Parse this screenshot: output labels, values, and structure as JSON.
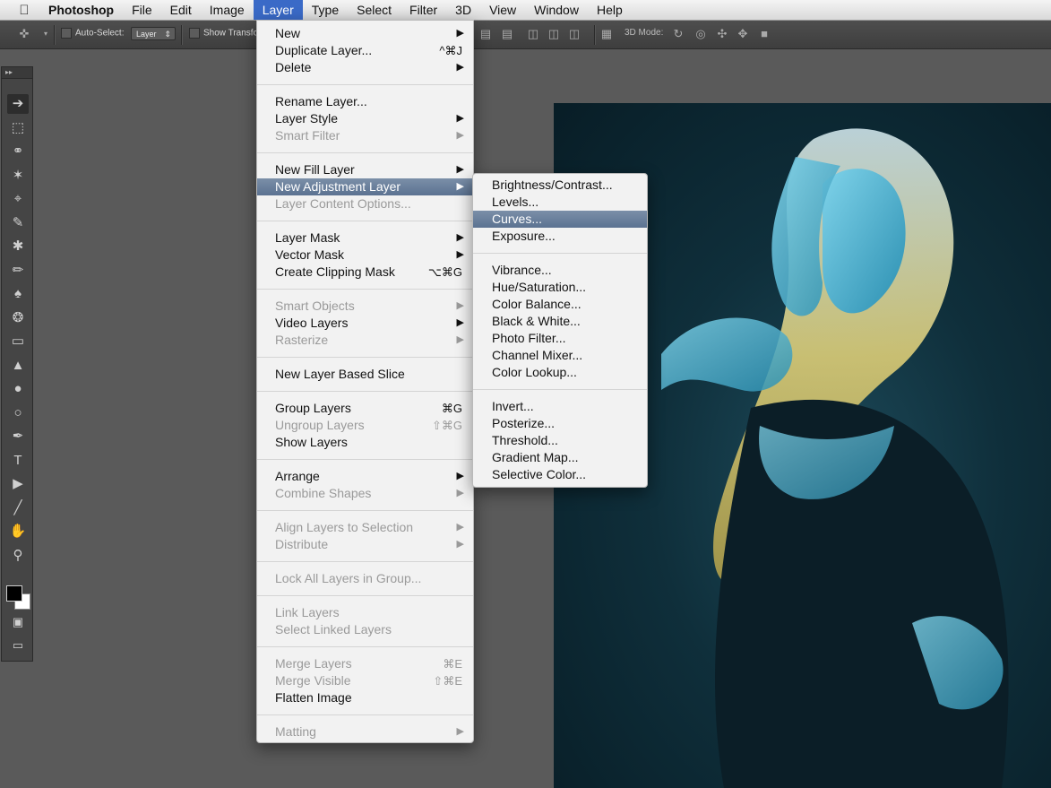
{
  "menubar": {
    "apple": "",
    "items": [
      "Photoshop",
      "File",
      "Edit",
      "Image",
      "Layer",
      "Type",
      "Select",
      "Filter",
      "3D",
      "View",
      "Window",
      "Help"
    ],
    "active": "Layer"
  },
  "options_bar": {
    "auto_select_label": "Auto-Select:",
    "auto_select_value": "Layer",
    "show_transform_label": "Show Transfo",
    "mode_3d_label": "3D Mode:"
  },
  "layer_menu": {
    "groups": [
      [
        {
          "label": "New",
          "submenu": true
        },
        {
          "label": "Duplicate Layer...",
          "shortcut": "^⌘J"
        },
        {
          "label": "Delete",
          "submenu": true
        }
      ],
      [
        {
          "label": "Rename Layer..."
        },
        {
          "label": "Layer Style",
          "submenu": true
        },
        {
          "label": "Smart Filter",
          "submenu": true,
          "disabled": true
        }
      ],
      [
        {
          "label": "New Fill Layer",
          "submenu": true
        },
        {
          "label": "New Adjustment Layer",
          "submenu": true,
          "highlighted": true
        },
        {
          "label": "Layer Content Options...",
          "disabled": true
        }
      ],
      [
        {
          "label": "Layer Mask",
          "submenu": true
        },
        {
          "label": "Vector Mask",
          "submenu": true
        },
        {
          "label": "Create Clipping Mask",
          "shortcut": "⌥⌘G"
        }
      ],
      [
        {
          "label": "Smart Objects",
          "submenu": true,
          "disabled": true
        },
        {
          "label": "Video Layers",
          "submenu": true
        },
        {
          "label": "Rasterize",
          "submenu": true,
          "disabled": true
        }
      ],
      [
        {
          "label": "New Layer Based Slice"
        }
      ],
      [
        {
          "label": "Group Layers",
          "shortcut": "⌘G"
        },
        {
          "label": "Ungroup Layers",
          "shortcut": "⇧⌘G",
          "disabled": true
        },
        {
          "label": "Show Layers"
        }
      ],
      [
        {
          "label": "Arrange",
          "submenu": true
        },
        {
          "label": "Combine Shapes",
          "submenu": true,
          "disabled": true
        }
      ],
      [
        {
          "label": "Align Layers to Selection",
          "submenu": true,
          "disabled": true
        },
        {
          "label": "Distribute",
          "submenu": true,
          "disabled": true
        }
      ],
      [
        {
          "label": "Lock All Layers in Group...",
          "disabled": true
        }
      ],
      [
        {
          "label": "Link Layers",
          "disabled": true
        },
        {
          "label": "Select Linked Layers",
          "disabled": true
        }
      ],
      [
        {
          "label": "Merge Layers",
          "shortcut": "⌘E",
          "disabled": true
        },
        {
          "label": "Merge Visible",
          "shortcut": "⇧⌘E",
          "disabled": true
        },
        {
          "label": "Flatten Image"
        }
      ],
      [
        {
          "label": "Matting",
          "submenu": true,
          "disabled": true
        }
      ]
    ]
  },
  "adjustment_menu": {
    "groups": [
      [
        {
          "label": "Brightness/Contrast..."
        },
        {
          "label": "Levels..."
        },
        {
          "label": "Curves...",
          "highlighted": true
        },
        {
          "label": "Exposure..."
        }
      ],
      [
        {
          "label": "Vibrance..."
        },
        {
          "label": "Hue/Saturation..."
        },
        {
          "label": "Color Balance..."
        },
        {
          "label": "Black & White..."
        },
        {
          "label": "Photo Filter..."
        },
        {
          "label": "Channel Mixer..."
        },
        {
          "label": "Color Lookup..."
        }
      ],
      [
        {
          "label": "Invert..."
        },
        {
          "label": "Posterize..."
        },
        {
          "label": "Threshold..."
        },
        {
          "label": "Gradient Map..."
        },
        {
          "label": "Selective Color..."
        }
      ]
    ]
  },
  "tools": [
    "move-tool",
    "marquee-tool",
    "lasso-tool",
    "magic-wand-tool",
    "crop-tool",
    "eyedropper-tool",
    "healing-brush-tool",
    "brush-tool",
    "clone-stamp-tool",
    "history-brush-tool",
    "eraser-tool",
    "paint-bucket-tool",
    "blur-tool",
    "dodge-tool",
    "pen-tool",
    "type-tool",
    "path-selection-tool",
    "line-tool",
    "hand-tool",
    "zoom-tool"
  ],
  "colors": {
    "menu_highlight": "#5b7291",
    "menubar_active": "#3a6ac7",
    "foreground_swatch": "#000000",
    "background_swatch": "#ffffff"
  }
}
